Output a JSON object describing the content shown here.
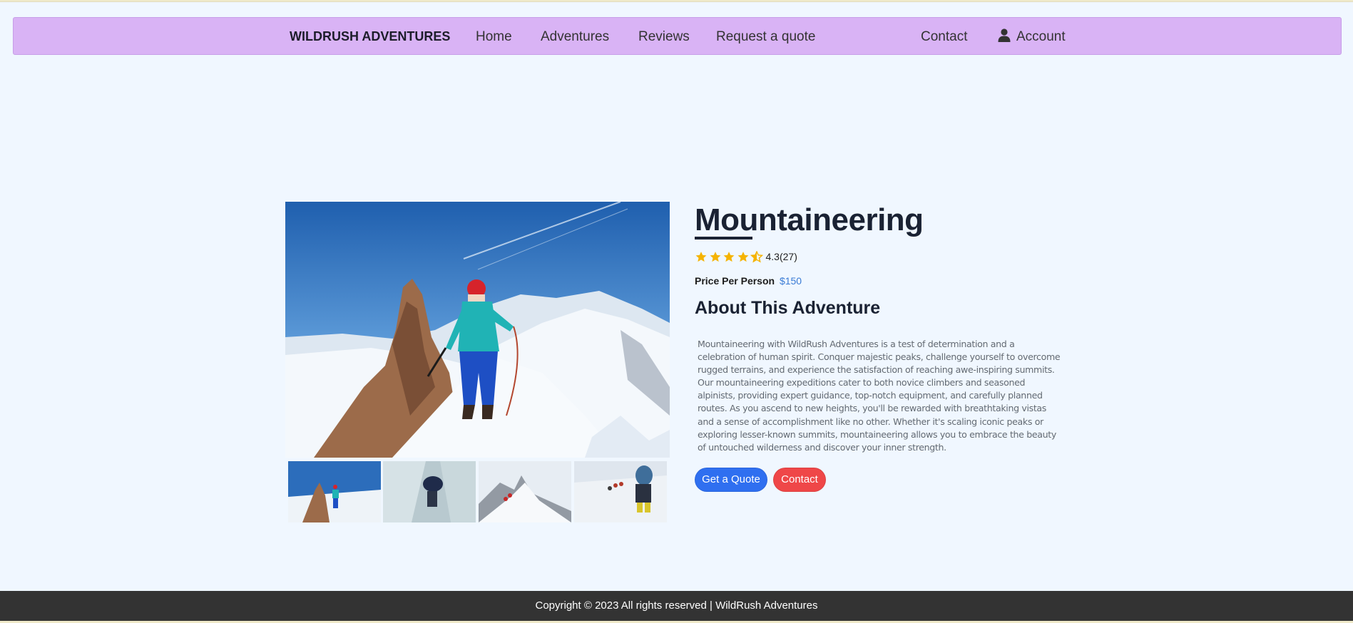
{
  "nav": {
    "brand": "WILDRUSH ADVENTURES",
    "links": [
      "Home",
      "Adventures",
      "Reviews",
      "Request a quote"
    ],
    "contact": "Contact",
    "account": "Account",
    "account_icon": "user-icon"
  },
  "adventure": {
    "title": "Mountaineering",
    "rating_value": "4.3",
    "rating_count": "(27)",
    "rating_stars": 4.5,
    "price_label": "Price Per Person",
    "price_value": "$150",
    "about_heading": "About This Adventure",
    "description": "Mountaineering with WildRush Adventures is a test of determination and a celebration of human spirit. Conquer majestic peaks, challenge yourself to overcome rugged terrains, and experience the satisfaction of reaching awe-inspiring summits. Our mountaineering expeditions cater to both novice climbers and seasoned alpinists, providing expert guidance, top-notch equipment, and carefully planned routes. As you ascend to new heights, you'll be rewarded with breathtaking vistas and a sense of accomplishment like no other. Whether it's scaling iconic peaks or exploring lesser-known summits, mountaineering allows you to embrace the beauty of untouched wilderness and discover your inner strength.",
    "quote_button": "Get a Quote",
    "contact_button": "Contact"
  },
  "colors": {
    "navbar": "#d9b3f5",
    "page_bg": "#f0f7ff",
    "star": "#f5b301",
    "price": "#3a7bd5",
    "quote_button": "#2f6ff0",
    "contact_button": "#ef4748",
    "footer": "#333333"
  },
  "footer": {
    "copyright": "Copyright © 2023 All rights reserved | WildRush Adventures"
  }
}
